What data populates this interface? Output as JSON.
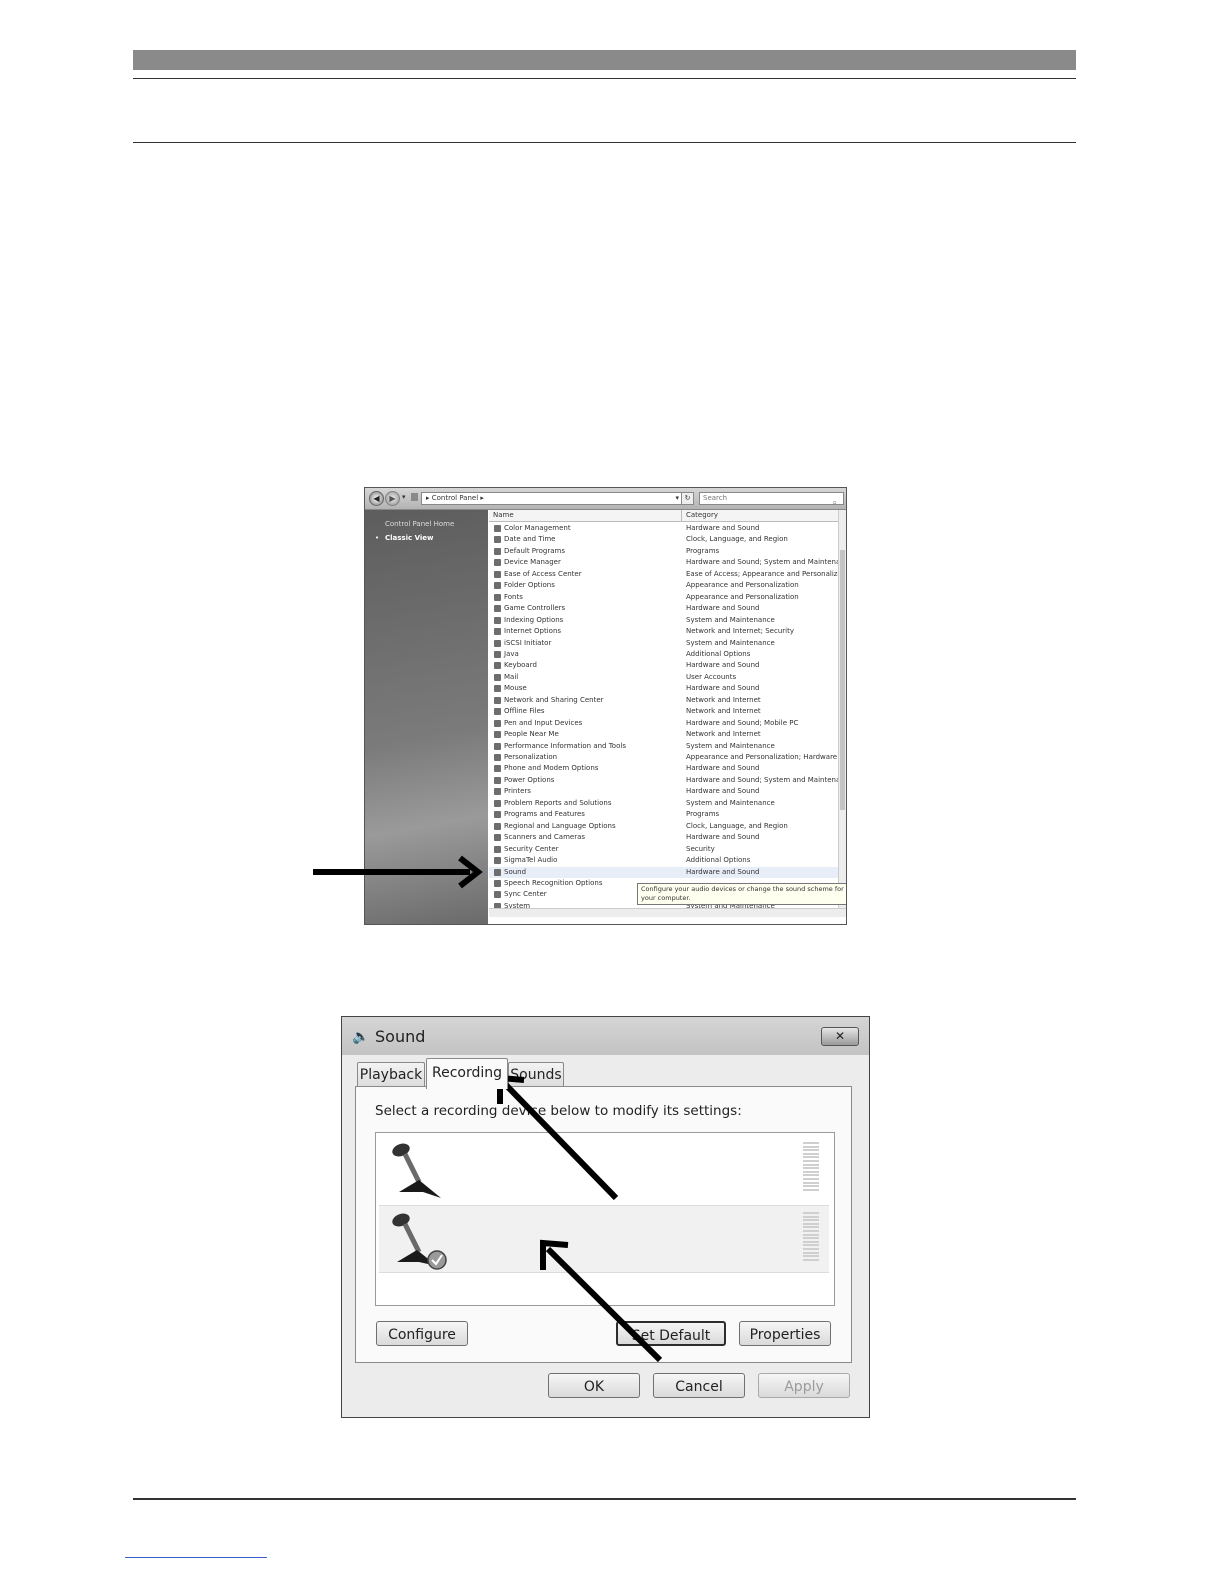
{
  "control_panel": {
    "breadcrumb": "Control Panel",
    "search_placeholder": "Search",
    "sidebar": {
      "home": "Control Panel Home",
      "classic_view": "Classic View"
    },
    "columns": {
      "name": "Name",
      "category": "Category"
    },
    "items": [
      {
        "name": "Color Management",
        "category": "Hardware and Sound"
      },
      {
        "name": "Date and Time",
        "category": "Clock, Language, and Region"
      },
      {
        "name": "Default Programs",
        "category": "Programs"
      },
      {
        "name": "Device Manager",
        "category": "Hardware and Sound; System and Maintenance"
      },
      {
        "name": "Ease of Access Center",
        "category": "Ease of Access; Appearance and Personalization"
      },
      {
        "name": "Folder Options",
        "category": "Appearance and Personalization"
      },
      {
        "name": "Fonts",
        "category": "Appearance and Personalization"
      },
      {
        "name": "Game Controllers",
        "category": "Hardware and Sound"
      },
      {
        "name": "Indexing Options",
        "category": "System and Maintenance"
      },
      {
        "name": "Internet Options",
        "category": "Network and Internet; Security"
      },
      {
        "name": "iSCSI Initiator",
        "category": "System and Maintenance"
      },
      {
        "name": "Java",
        "category": "Additional Options"
      },
      {
        "name": "Keyboard",
        "category": "Hardware and Sound"
      },
      {
        "name": "Mail",
        "category": "User Accounts"
      },
      {
        "name": "Mouse",
        "category": "Hardware and Sound"
      },
      {
        "name": "Network and Sharing Center",
        "category": "Network and Internet"
      },
      {
        "name": "Offline Files",
        "category": "Network and Internet"
      },
      {
        "name": "Pen and Input Devices",
        "category": "Hardware and Sound; Mobile PC"
      },
      {
        "name": "People Near Me",
        "category": "Network and Internet"
      },
      {
        "name": "Performance Information and Tools",
        "category": "System and Maintenance"
      },
      {
        "name": "Personalization",
        "category": "Appearance and Personalization; Hardware and Sound"
      },
      {
        "name": "Phone and Modem Options",
        "category": "Hardware and Sound"
      },
      {
        "name": "Power Options",
        "category": "Hardware and Sound; System and Maintenance"
      },
      {
        "name": "Printers",
        "category": "Hardware and Sound"
      },
      {
        "name": "Problem Reports and Solutions",
        "category": "System and Maintenance"
      },
      {
        "name": "Programs and Features",
        "category": "Programs"
      },
      {
        "name": "Regional and Language Options",
        "category": "Clock, Language, and Region"
      },
      {
        "name": "Scanners and Cameras",
        "category": "Hardware and Sound"
      },
      {
        "name": "Security Center",
        "category": "Security"
      },
      {
        "name": "SigmaTel Audio",
        "category": "Additional Options"
      },
      {
        "name": "Sound",
        "category": "Hardware and Sound"
      },
      {
        "name": "Speech Recognition Options",
        "category": ""
      },
      {
        "name": "Sync Center",
        "category": ""
      },
      {
        "name": "System",
        "category": "System and Maintenance"
      }
    ],
    "tooltip": "Configure your audio devices or change the sound scheme for your computer."
  },
  "sound_dialog": {
    "title": "Sound",
    "tabs": [
      "Playback",
      "Recording",
      "Sounds"
    ],
    "instruction": "Select a recording device below to modify its settings:",
    "buttons": {
      "configure": "Configure",
      "set_default": "Set Default",
      "properties": "Properties",
      "ok": "OK",
      "cancel": "Cancel",
      "apply": "Apply"
    }
  }
}
